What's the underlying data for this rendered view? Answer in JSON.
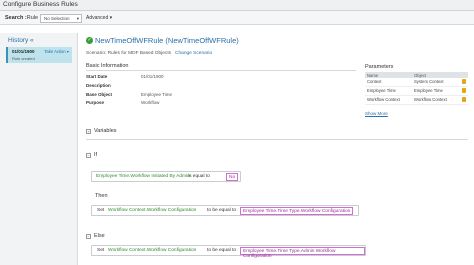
{
  "window": {
    "title": "Configure Business Rules"
  },
  "search": {
    "label": "Search :",
    "category": "Rule",
    "selection": "No Selection",
    "advanced": "Advanced"
  },
  "history": {
    "title": "History",
    "item_date": "01/01/1900",
    "item_action": "Take Action",
    "item_status": "Rule created"
  },
  "rule": {
    "title": "NewTimeOffWFRule (NewTimeOffWFRule)",
    "scenario": "Scenario: Rules for MDF Based Objects",
    "change_scenario": "Change Scenario"
  },
  "basic_info": {
    "heading": "Basic Information",
    "fields": [
      {
        "label": "Start Date",
        "value": "01/01/1900"
      },
      {
        "label": "Description",
        "value": ""
      },
      {
        "label": "Base Object",
        "value": "Employee Time"
      },
      {
        "label": "Purpose",
        "value": "Workflow"
      }
    ]
  },
  "parameters": {
    "heading": "Parameters",
    "columns": [
      "Name",
      "Object"
    ],
    "rows": [
      {
        "name": "Context",
        "object": "System Context",
        "icon": "lock-icon"
      },
      {
        "name": "Employee Time",
        "object": "Employee Time",
        "icon": "lock-icon"
      },
      {
        "name": "Workflow Context",
        "object": "Workflow Context",
        "icon": "lock-icon"
      }
    ],
    "show_more": "Show More"
  },
  "variables": {
    "heading": "Variables"
  },
  "if_block": {
    "label": "If",
    "left": "Employee Time.Workflow Initiated By Admin",
    "operator": "is equal to",
    "right": "No"
  },
  "then_block": {
    "label": "Then",
    "keyword": "Set",
    "target": "Workflow Context.Workflow Configuration",
    "operator": "to be equal to",
    "value": "Employee Time.Time Type.Workflow Configuration"
  },
  "else_block": {
    "label": "Else",
    "keyword": "Set",
    "target": "Workflow Context.Workflow Configuration",
    "operator": "to be equal to",
    "value": "Employee Time.Time Type.Admin Workflow Configuration"
  },
  "colors": {
    "accent": "#2a6fa8",
    "success": "#3a9b3a",
    "field": "#2f8a2f",
    "value": "#9a2f9a"
  }
}
